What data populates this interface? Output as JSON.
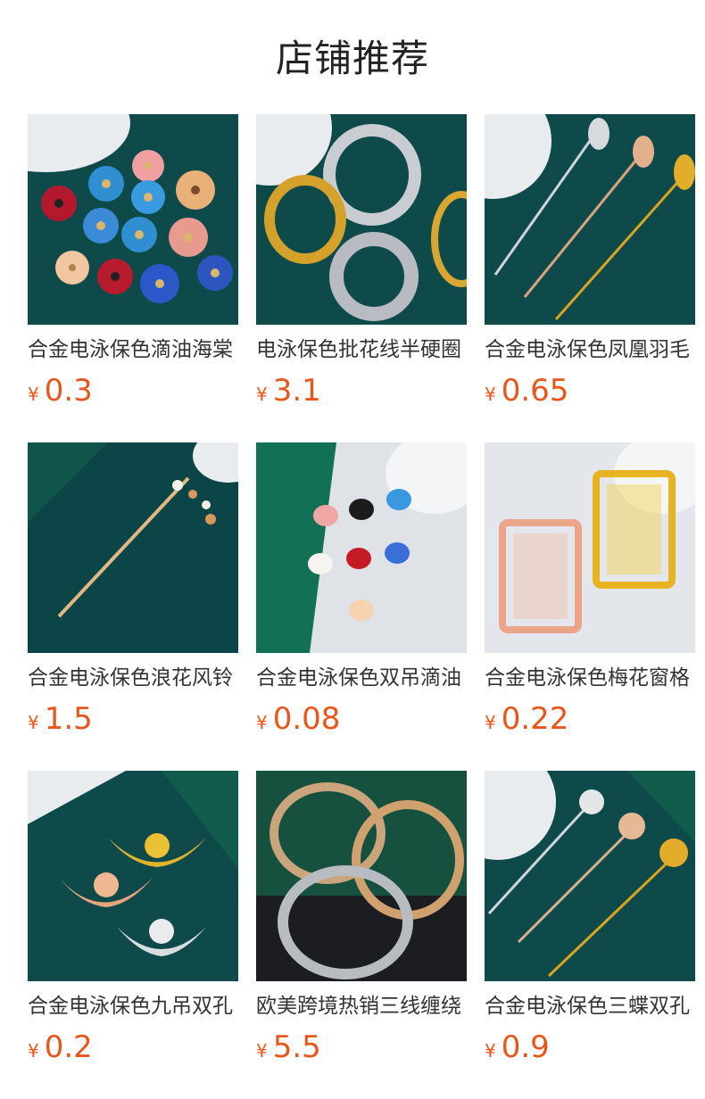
{
  "header": {
    "title": "店铺推荐"
  },
  "currency_symbol": "¥",
  "products": [
    {
      "name": "合金电泳保色滴油海棠",
      "price": "0.3",
      "image": "enamel-flowers"
    },
    {
      "name": "电泳保色批花线半硬圈",
      "price": "3.1",
      "image": "wire-coils"
    },
    {
      "name": "合金电泳保色凤凰羽毛",
      "price": "0.65",
      "image": "feather-hairpins"
    },
    {
      "name": "合金电泳保色浪花风铃",
      "price": "1.5",
      "image": "tassel-hairpin"
    },
    {
      "name": "合金电泳保色双吊滴油",
      "price": "0.08",
      "image": "butterfly-charms"
    },
    {
      "name": "合金电泳保色梅花窗格",
      "price": "0.22",
      "image": "window-frames"
    },
    {
      "name": "合金电泳保色九吊双孔",
      "price": "0.2",
      "image": "lotus-connectors"
    },
    {
      "name": "欧美跨境热销三线缠绕",
      "price": "5.5",
      "image": "bangles"
    },
    {
      "name": "合金电泳保色三蝶双孔",
      "price": "0.9",
      "image": "butterfly-hairpins"
    }
  ]
}
